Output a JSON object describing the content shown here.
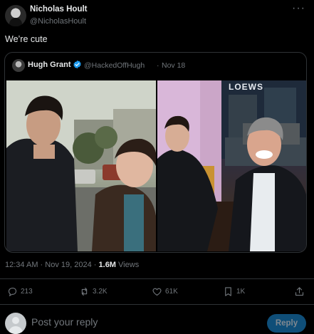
{
  "author": {
    "name": "Nicholas Hoult",
    "handle": "@NicholasHoult"
  },
  "tweet": {
    "text": "We’re cute",
    "more_icon": "ellipsis-icon"
  },
  "quote": {
    "name": "Hugh Grant",
    "handle": "@HackedOffHugh",
    "separator": "·",
    "date": "Nov 18",
    "verified_icon": "verified-badge-icon",
    "photo_sign": "LOEWS"
  },
  "meta": {
    "time": "12:34 AM",
    "separator": "·",
    "date": "Nov 19, 2024",
    "separator2": "·",
    "views_count": "1.6M",
    "views_label": "Views"
  },
  "actions": {
    "replies": "213",
    "reposts": "3.2K",
    "likes": "61K",
    "bookmarks": "1K"
  },
  "reply_bar": {
    "placeholder": "Post your reply",
    "button": "Reply"
  },
  "colors": {
    "accent": "#1d9bf0",
    "background": "#000000",
    "muted": "#71767b"
  }
}
